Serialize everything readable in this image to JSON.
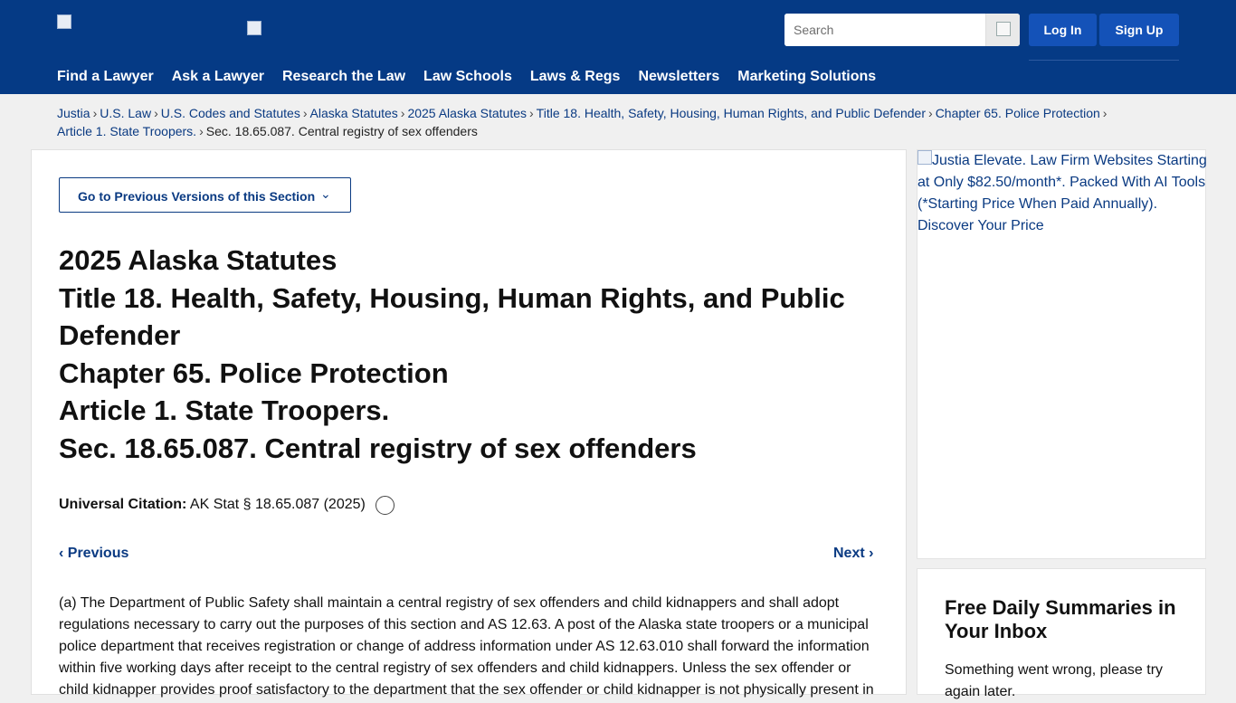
{
  "header": {
    "search": {
      "placeholder": "Search"
    },
    "login_label": "Log In",
    "signup_label": "Sign Up",
    "nav": [
      {
        "label": "Find a Lawyer"
      },
      {
        "label": "Ask a Lawyer"
      },
      {
        "label": "Research the Law"
      },
      {
        "label": "Law Schools"
      },
      {
        "label": "Laws & Regs"
      },
      {
        "label": "Newsletters"
      },
      {
        "label": "Marketing Solutions"
      }
    ]
  },
  "breadcrumb": {
    "items": [
      {
        "label": "Justia"
      },
      {
        "label": "U.S. Law"
      },
      {
        "label": "U.S. Codes and Statutes"
      },
      {
        "label": "Alaska Statutes"
      },
      {
        "label": "2025 Alaska Statutes"
      },
      {
        "label": "Title 18. Health, Safety, Housing, Human Rights, and Public Defender"
      },
      {
        "label": "Chapter 65. Police Protection"
      },
      {
        "label": "Article 1. State Troopers."
      }
    ],
    "current": "Sec. 18.65.087. Central registry of sex offenders",
    "separator": "›"
  },
  "main": {
    "prev_versions_label": "Go to Previous Versions of this Section",
    "headings": [
      "2025 Alaska Statutes",
      "Title 18. Health, Safety, Housing, Human Rights, and Public Defender",
      "Chapter 65. Police Protection",
      "Article 1. State Troopers.",
      "Sec. 18.65.087. Central registry of sex offenders"
    ],
    "citation_label": "Universal Citation:",
    "citation_value": "AK Stat § 18.65.087 (2025)",
    "prev_label": "Previous",
    "next_label": "Next",
    "body_text": "(a) The Department of Public Safety shall maintain a central registry of sex offenders and child kidnappers and shall adopt regulations necessary to carry out the purposes of this section and AS 12.63. A post of the Alaska state troopers or a municipal police department that receives registration or change of address information under AS 12.63.010 shall forward the information within five working days after receipt to the central registry of sex offenders and child kidnappers. Unless the sex offender or child kidnapper provides proof satisfactory to the department that the sex offender or child kidnapper is not physically present in"
  },
  "sidebar": {
    "ad_alt": "Justia Elevate. Law Firm Websites Starting at Only $82.50/month*. Packed With AI Tools (*Starting Price When Paid Annually). Discover Your Price",
    "newsletter_title": "Free Daily Summaries in Your Inbox",
    "newsletter_msg": "Something went wrong, please try again later."
  },
  "icons": {
    "chevron-down": "⌄",
    "chevron-left": "‹",
    "chevron-right": "›"
  }
}
